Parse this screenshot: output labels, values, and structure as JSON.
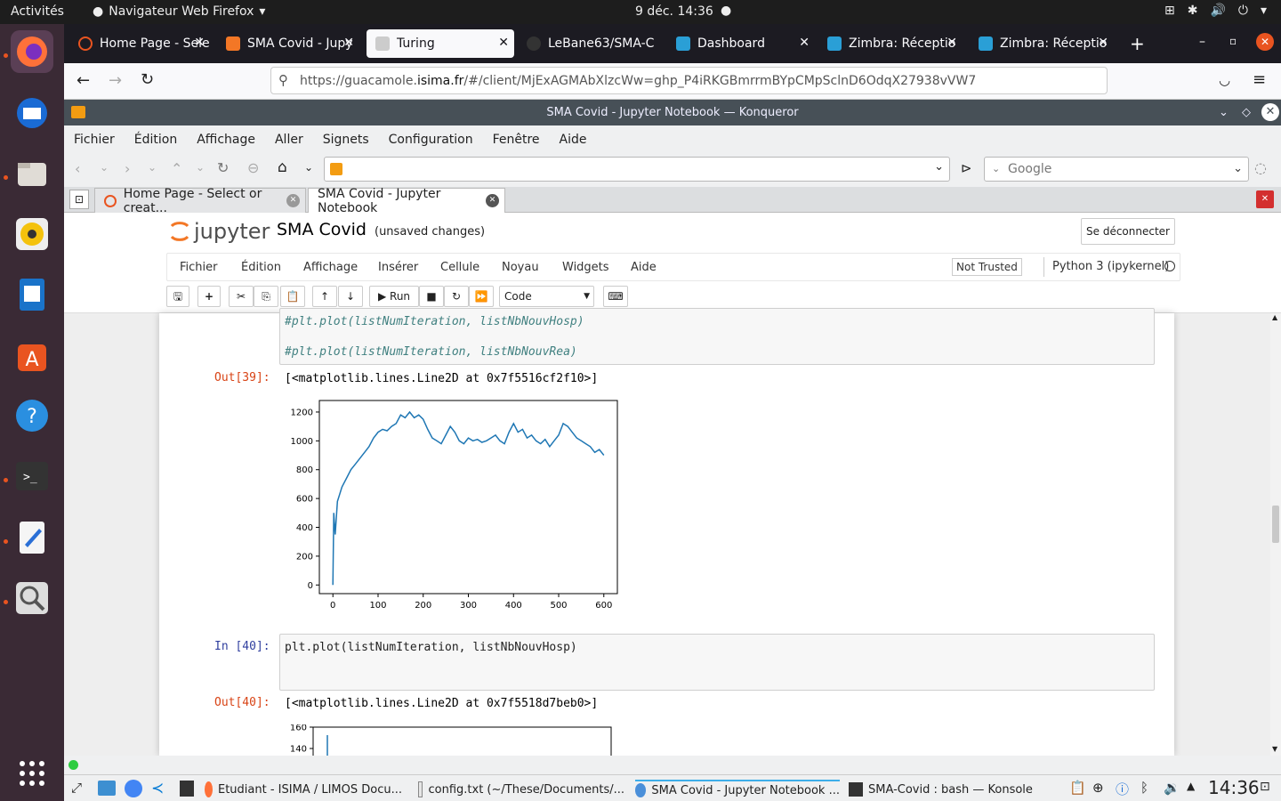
{
  "topbar": {
    "activities": "Activités",
    "app": "Navigateur Web Firefox",
    "clock": "9 déc.  14:36"
  },
  "firefox": {
    "tabs": [
      {
        "label": "Home Page - Sele",
        "color": "#e95420"
      },
      {
        "label": "SMA Covid - Jupy",
        "color": "#f37726"
      },
      {
        "label": "Turing",
        "color": "#888888"
      },
      {
        "label": "LeBane63/SMA-C",
        "color": "#ffffff"
      },
      {
        "label": "Dashboard",
        "color": "#2a9fd6"
      },
      {
        "label": "Zimbra: Réceptio",
        "color": "#2a9fd6"
      },
      {
        "label": "Zimbra: Réceptio",
        "color": "#2a9fd6"
      }
    ],
    "url_prefix": "https://guacamole.",
    "url_host": "isima.fr",
    "url_rest": "/#/client/MjExAGMAbXlzcWw=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"
  },
  "konqueror": {
    "title": "SMA Covid - Jupyter Notebook — Konqueror",
    "menu": [
      "Fichier",
      "Édition",
      "Affichage",
      "Aller",
      "Signets",
      "Configuration",
      "Fenêtre",
      "Aide"
    ],
    "search_placeholder": "Google",
    "tabs": [
      "Home Page - Select or creat...",
      "SMA Covid - Jupyter Notebook"
    ]
  },
  "jupyter": {
    "logo": "jupyter",
    "notebook_name": "SMA Covid",
    "save_status": "(unsaved changes)",
    "logout": "Se déconnecter",
    "menu": [
      "Fichier",
      "Édition",
      "Affichage",
      "Insérer",
      "Cellule",
      "Noyau",
      "Widgets",
      "Aide"
    ],
    "trusted": "Not Trusted",
    "kernel": "Python 3 (ipykernel)",
    "toolbar": {
      "run": "Run",
      "celltype": "Code"
    },
    "cells": {
      "c39_line1": "#plt.plot(listNumIteration, listNbNouvHosp)",
      "c39_line2": "#plt.plot(listNumIteration, listNbNouvRea)",
      "out39_prompt": "Out[39]:",
      "out39_text": "[<matplotlib.lines.Line2D at 0x7f5516cf2f10>]",
      "in40_prompt": "In [40]:",
      "in40_code": "plt.plot(listNumIteration, listNbNouvHosp)",
      "out40_prompt": "Out[40]:",
      "out40_text": "[<matplotlib.lines.Line2D at 0x7f5518d7beb0>]"
    }
  },
  "taskbar": {
    "tasks": [
      "Etudiant - ISIMA / LIMOS Docu...",
      "config.txt (~/These/Documents/...",
      "SMA Covid - Jupyter Notebook ...",
      "SMA-Covid : bash — Konsole"
    ],
    "clock": "14:36"
  },
  "chart_data": [
    {
      "type": "line",
      "x": [
        0,
        2,
        5,
        10,
        20,
        30,
        40,
        50,
        60,
        70,
        80,
        90,
        100,
        110,
        120,
        130,
        140,
        150,
        160,
        170,
        180,
        190,
        200,
        210,
        220,
        230,
        240,
        250,
        260,
        270,
        280,
        290,
        300,
        310,
        320,
        330,
        340,
        350,
        360,
        370,
        380,
        390,
        400,
        410,
        420,
        430,
        440,
        450,
        460,
        470,
        480,
        490,
        500,
        510,
        520,
        530,
        540,
        550,
        560,
        570,
        580,
        590,
        600
      ],
      "series": [
        {
          "values": [
            0,
            500,
            350,
            580,
            680,
            740,
            800,
            840,
            880,
            920,
            960,
            1020,
            1060,
            1080,
            1070,
            1100,
            1120,
            1180,
            1160,
            1200,
            1160,
            1180,
            1150,
            1080,
            1020,
            1000,
            980,
            1040,
            1100,
            1060,
            1000,
            980,
            1020,
            1000,
            1010,
            990,
            1000,
            1020,
            1040,
            1000,
            980,
            1060,
            1120,
            1060,
            1080,
            1020,
            1040,
            1000,
            980,
            1010,
            960,
            1000,
            1040,
            1120,
            1100,
            1060,
            1020,
            1000,
            980,
            960,
            920,
            940,
            900
          ]
        }
      ],
      "xticks": [
        0,
        100,
        200,
        300,
        400,
        500,
        600
      ],
      "yticks": [
        0,
        200,
        400,
        600,
        800,
        1000,
        1200
      ],
      "xlim": [
        -30,
        630
      ],
      "ylim": [
        -60,
        1280
      ],
      "color": "#1f77b4"
    },
    {
      "type": "line",
      "yticks": [
        160,
        140
      ],
      "partial": true
    }
  ]
}
